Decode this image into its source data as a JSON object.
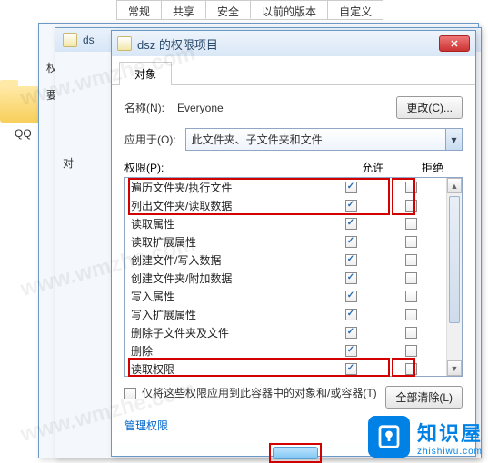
{
  "watermarks": [
    "www.wmzhe.com",
    "www.wmzhe.com",
    "www.wmzhe.com"
  ],
  "bg": {
    "qq_label": "QQ"
  },
  "parent_tabs": [
    "常规",
    "共享",
    "安全",
    "以前的版本",
    "自定义"
  ],
  "parent_active_index": 2,
  "win1": {
    "side1": "权",
    "side2": "要"
  },
  "win2": {
    "title_prefix": "ds",
    "side": "对"
  },
  "win3": {
    "title": "dsz 的权限项目",
    "tab": "对象",
    "name_label": "名称(N):",
    "name_value": "Everyone",
    "change_btn": "更改(C)...",
    "apply_to_label": "应用于(O):",
    "apply_to_value": "此文件夹、子文件夹和文件",
    "perm_label": "权限(P):",
    "allow_label": "允许",
    "deny_label": "拒绝",
    "permissions": [
      {
        "label": "遍历文件夹/执行文件",
        "allow": true,
        "deny": false
      },
      {
        "label": "列出文件夹/读取数据",
        "allow": true,
        "deny": false
      },
      {
        "label": "读取属性",
        "allow": true,
        "deny": false
      },
      {
        "label": "读取扩展属性",
        "allow": true,
        "deny": false
      },
      {
        "label": "创建文件/写入数据",
        "allow": true,
        "deny": false
      },
      {
        "label": "创建文件夹/附加数据",
        "allow": true,
        "deny": false
      },
      {
        "label": "写入属性",
        "allow": true,
        "deny": false
      },
      {
        "label": "写入扩展属性",
        "allow": true,
        "deny": false
      },
      {
        "label": "删除子文件夹及文件",
        "allow": true,
        "deny": false
      },
      {
        "label": "删除",
        "allow": true,
        "deny": false
      },
      {
        "label": "读取权限",
        "allow": true,
        "deny": false
      }
    ],
    "only_apply_label": "仅将这些权限应用到此容器中的对象和/或容器(T)",
    "clear_all_btn": "全部清除(L)",
    "manage_link": "管理权限"
  },
  "brand": {
    "cn": "知识屋",
    "en": "zhishiwu.com"
  }
}
